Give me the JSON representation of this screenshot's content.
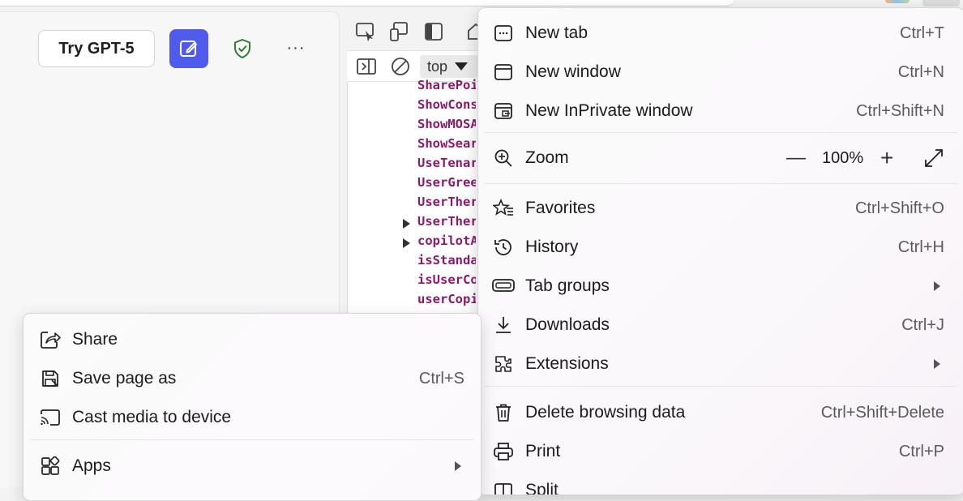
{
  "page": {
    "try_button": "Try GPT-5",
    "more_label": "···"
  },
  "devtools": {
    "context_select": "top",
    "properties": [
      {
        "name": "SharePoi",
        "expandable": false
      },
      {
        "name": "ShowCons",
        "expandable": false
      },
      {
        "name": "ShowMOSA",
        "expandable": false
      },
      {
        "name": "ShowSear",
        "expandable": false
      },
      {
        "name": "UseTenar",
        "expandable": false
      },
      {
        "name": "UserGree",
        "expandable": false
      },
      {
        "name": "UserTher",
        "expandable": false
      },
      {
        "name": "UserTher",
        "expandable": true
      },
      {
        "name": "copilotA",
        "expandable": true
      },
      {
        "name": "isStanda",
        "expandable": false
      },
      {
        "name": "isUserCo",
        "expandable": false
      },
      {
        "name": "userCopi",
        "expandable": false
      }
    ]
  },
  "menu": {
    "new_tab": {
      "label": "New tab",
      "shortcut": "Ctrl+T",
      "icon": "new-tab-icon"
    },
    "new_window": {
      "label": "New window",
      "shortcut": "Ctrl+N",
      "icon": "window-icon"
    },
    "new_inprivate": {
      "label": "New InPrivate window",
      "shortcut": "Ctrl+Shift+N",
      "icon": "inprivate-icon"
    },
    "zoom": {
      "label": "Zoom",
      "minus": "—",
      "value": "100%",
      "plus": "+",
      "icon": "zoom-icon"
    },
    "favorites": {
      "label": "Favorites",
      "shortcut": "Ctrl+Shift+O",
      "icon": "favorites-icon"
    },
    "history": {
      "label": "History",
      "shortcut": "Ctrl+H",
      "icon": "history-icon"
    },
    "tab_groups": {
      "label": "Tab groups",
      "icon": "tab-groups-icon"
    },
    "downloads": {
      "label": "Downloads",
      "shortcut": "Ctrl+J",
      "icon": "download-icon"
    },
    "extensions": {
      "label": "Extensions",
      "icon": "extensions-icon"
    },
    "delete_browsing": {
      "label": "Delete browsing data",
      "shortcut": "Ctrl+Shift+Delete",
      "icon": "trash-icon"
    },
    "print": {
      "label": "Print",
      "shortcut": "Ctrl+P",
      "icon": "print-icon"
    },
    "partial_next": {
      "label": "Split",
      "icon": "split-icon"
    }
  },
  "submenu": {
    "share": {
      "label": "Share",
      "icon": "share-icon"
    },
    "save_page": {
      "label": "Save page as",
      "shortcut": "Ctrl+S",
      "icon": "save-icon"
    },
    "cast": {
      "label": "Cast media to device",
      "icon": "cast-icon"
    },
    "apps": {
      "label": "Apps",
      "icon": "apps-icon"
    }
  },
  "colors": {
    "compose_button": "#4f5bea",
    "shield": "#2e7d32",
    "devtools_property": "#8b1a6f"
  }
}
